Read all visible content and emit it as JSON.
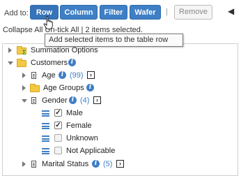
{
  "toolbar": {
    "add_to_label": "Add to:",
    "buttons": [
      "Row",
      "Column",
      "Filter",
      "Wafer"
    ],
    "separator": "|",
    "remove_label": "Remove",
    "back_glyph": "◀"
  },
  "status": {
    "collapse_all": "Collapse All",
    "untick_all": "Un-tick All",
    "separator": "|",
    "selection_text": "2 items selected."
  },
  "tooltip": "Add selected items to the table row",
  "tree": {
    "summation_options": "Summation Options",
    "customers": "Customers",
    "age": {
      "label": "Age",
      "count": "(99)"
    },
    "age_groups": "Age Groups",
    "gender": {
      "label": "Gender",
      "count": "(4)"
    },
    "gender_values": [
      {
        "label": "Male",
        "checked": true
      },
      {
        "label": "Female",
        "checked": true
      },
      {
        "label": "Unknown",
        "checked": false
      },
      {
        "label": "Not Applicable",
        "checked": false
      }
    ],
    "marital_status": {
      "label": "Marital Status",
      "count": "(5)"
    }
  },
  "icons": {
    "info_glyph": "i",
    "go_glyph": "›",
    "check_glyph": "✓"
  },
  "colors": {
    "primary": "#3f7fc5",
    "folder": "#f4c842"
  }
}
